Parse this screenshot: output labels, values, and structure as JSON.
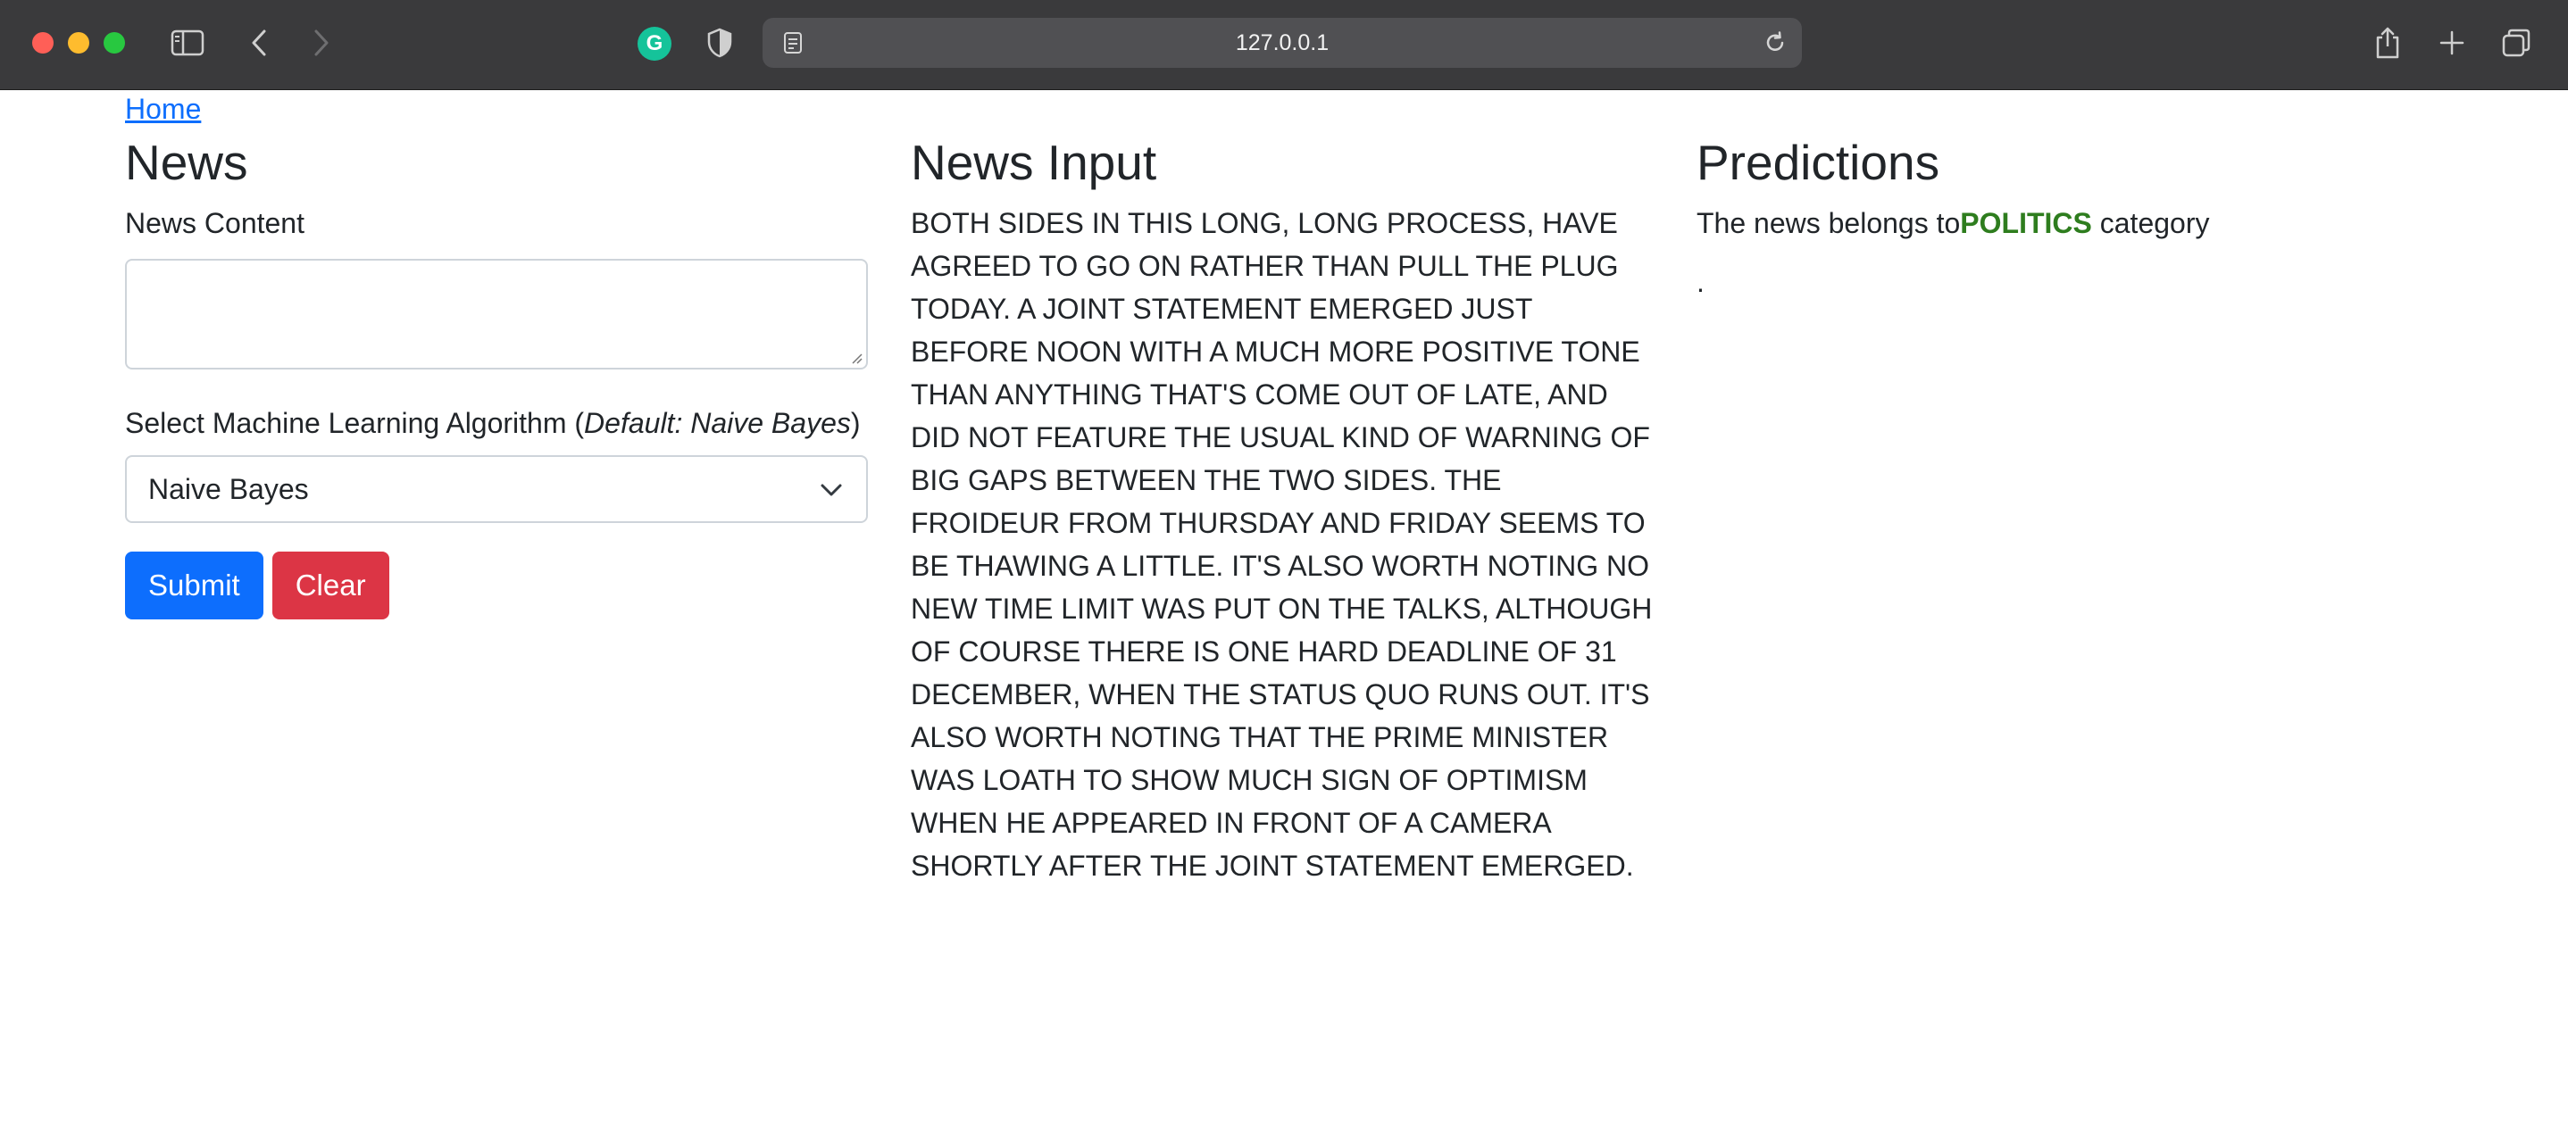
{
  "browser": {
    "address": "127.0.0.1"
  },
  "nav": {
    "home_link": "Home"
  },
  "news_form": {
    "heading": "News",
    "content_label": "News Content",
    "content_value": "",
    "algorithm_label_prefix": "Select Machine Learning Algorithm (",
    "algorithm_label_default": "Default: Naive Bayes",
    "algorithm_label_suffix": ")",
    "algorithm_selected": "Naive Bayes",
    "submit_label": "Submit",
    "clear_label": "Clear"
  },
  "news_input": {
    "heading": "News Input",
    "text": "BOTH SIDES IN THIS LONG, LONG PROCESS, HAVE AGREED TO GO ON RATHER THAN PULL THE PLUG TODAY. A JOINT STATEMENT EMERGED JUST BEFORE NOON WITH A MUCH MORE POSITIVE TONE THAN ANYTHING THAT'S COME OUT OF LATE, AND DID NOT FEATURE THE USUAL KIND OF WARNING OF BIG GAPS BETWEEN THE TWO SIDES. THE FROIDEUR FROM THURSDAY AND FRIDAY SEEMS TO BE THAWING A LITTLE. IT'S ALSO WORTH NOTING NO NEW TIME LIMIT WAS PUT ON THE TALKS, ALTHOUGH OF COURSE THERE IS ONE HARD DEADLINE OF 31 DECEMBER, WHEN THE STATUS QUO RUNS OUT. IT'S ALSO WORTH NOTING THAT THE PRIME MINISTER WAS LOATH TO SHOW MUCH SIGN OF OPTIMISM WHEN HE APPEARED IN FRONT OF A CAMERA SHORTLY AFTER THE JOINT STATEMENT EMERGED."
  },
  "predictions": {
    "heading": "Predictions",
    "prefix": "The news belongs to",
    "category": "POLITICS",
    "suffix": " category",
    "trailing": "."
  },
  "colors": {
    "primary": "#0d6efd",
    "danger": "#dc3545",
    "category": "#2e7d1e"
  }
}
